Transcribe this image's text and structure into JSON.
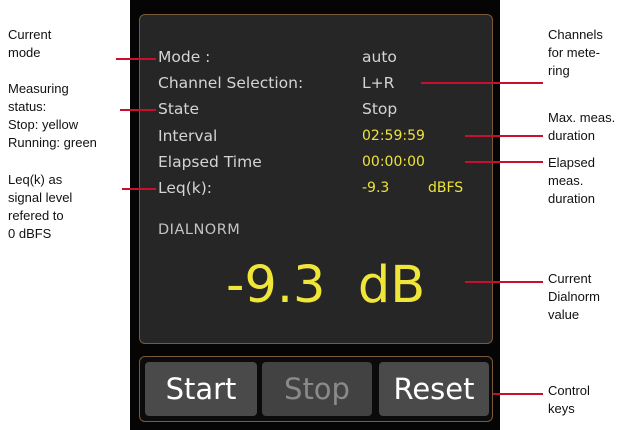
{
  "callouts": {
    "current_mode": [
      "Current",
      "mode"
    ],
    "measuring_status": [
      "Measuring",
      "status:",
      "Stop: yellow",
      "Running: green"
    ],
    "leq_signal": [
      "Leq(k) as",
      "signal level",
      "refered to",
      "0 dBFS"
    ],
    "channels": [
      "Channels",
      "for mete-",
      "ring"
    ],
    "max_duration": [
      "Max. meas.",
      "duration"
    ],
    "elapsed_duration": [
      "Elapsed",
      "meas.",
      "duration"
    ],
    "dialnorm_value": [
      "Current",
      "Dialnorm",
      "value"
    ],
    "control_keys": [
      "Control",
      "keys"
    ]
  },
  "screen": {
    "rows": {
      "mode": {
        "label": "Mode :",
        "value": "auto"
      },
      "channel": {
        "label": "Channel Selection:",
        "value": "L+R"
      },
      "state": {
        "label": "State",
        "value": "Stop"
      },
      "interval": {
        "label": "Interval",
        "value": "02:59:59"
      },
      "elapsed": {
        "label": "Elapsed Time",
        "value": "00:00:00"
      },
      "leq": {
        "label": "Leq(k):",
        "value": "-9.3",
        "unit": "dBFS"
      }
    },
    "dialnorm_title": "DIALNORM",
    "dialnorm_value": "-9.3  dB"
  },
  "keys": {
    "start": "Start",
    "stop": "Stop",
    "reset": "Reset"
  },
  "colors": {
    "leader": "#c8102e",
    "highlight_yellow": "#ece33a",
    "screen_border": "#7a5a3a"
  }
}
